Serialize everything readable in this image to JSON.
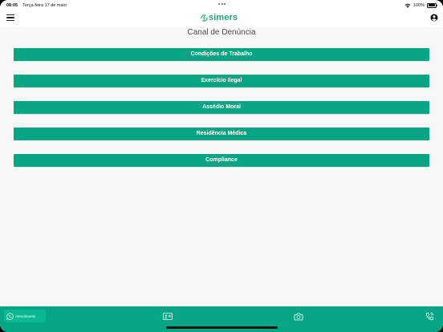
{
  "status_bar": {
    "time": "08:05",
    "date": "Terça-feira 17 de maio",
    "battery": "100%"
  },
  "header": {
    "logo_text": "simers",
    "brand_color": "#1ea87f"
  },
  "page": {
    "title": "Canal de Denúncia"
  },
  "menu": {
    "items": [
      {
        "label": "Condições de Trabalho"
      },
      {
        "label": "Exercício Ilegal"
      },
      {
        "label": "Assédio Moral"
      },
      {
        "label": "Residência Médica"
      },
      {
        "label": "Compliance"
      }
    ],
    "button_color": "#06a583"
  },
  "bottom_bar": {
    "whatsapp_label": "Atendimento",
    "icons": [
      "whatsapp-icon",
      "id-card-icon",
      "camera-icon",
      "phone-icon"
    ],
    "color": "#06a583"
  }
}
